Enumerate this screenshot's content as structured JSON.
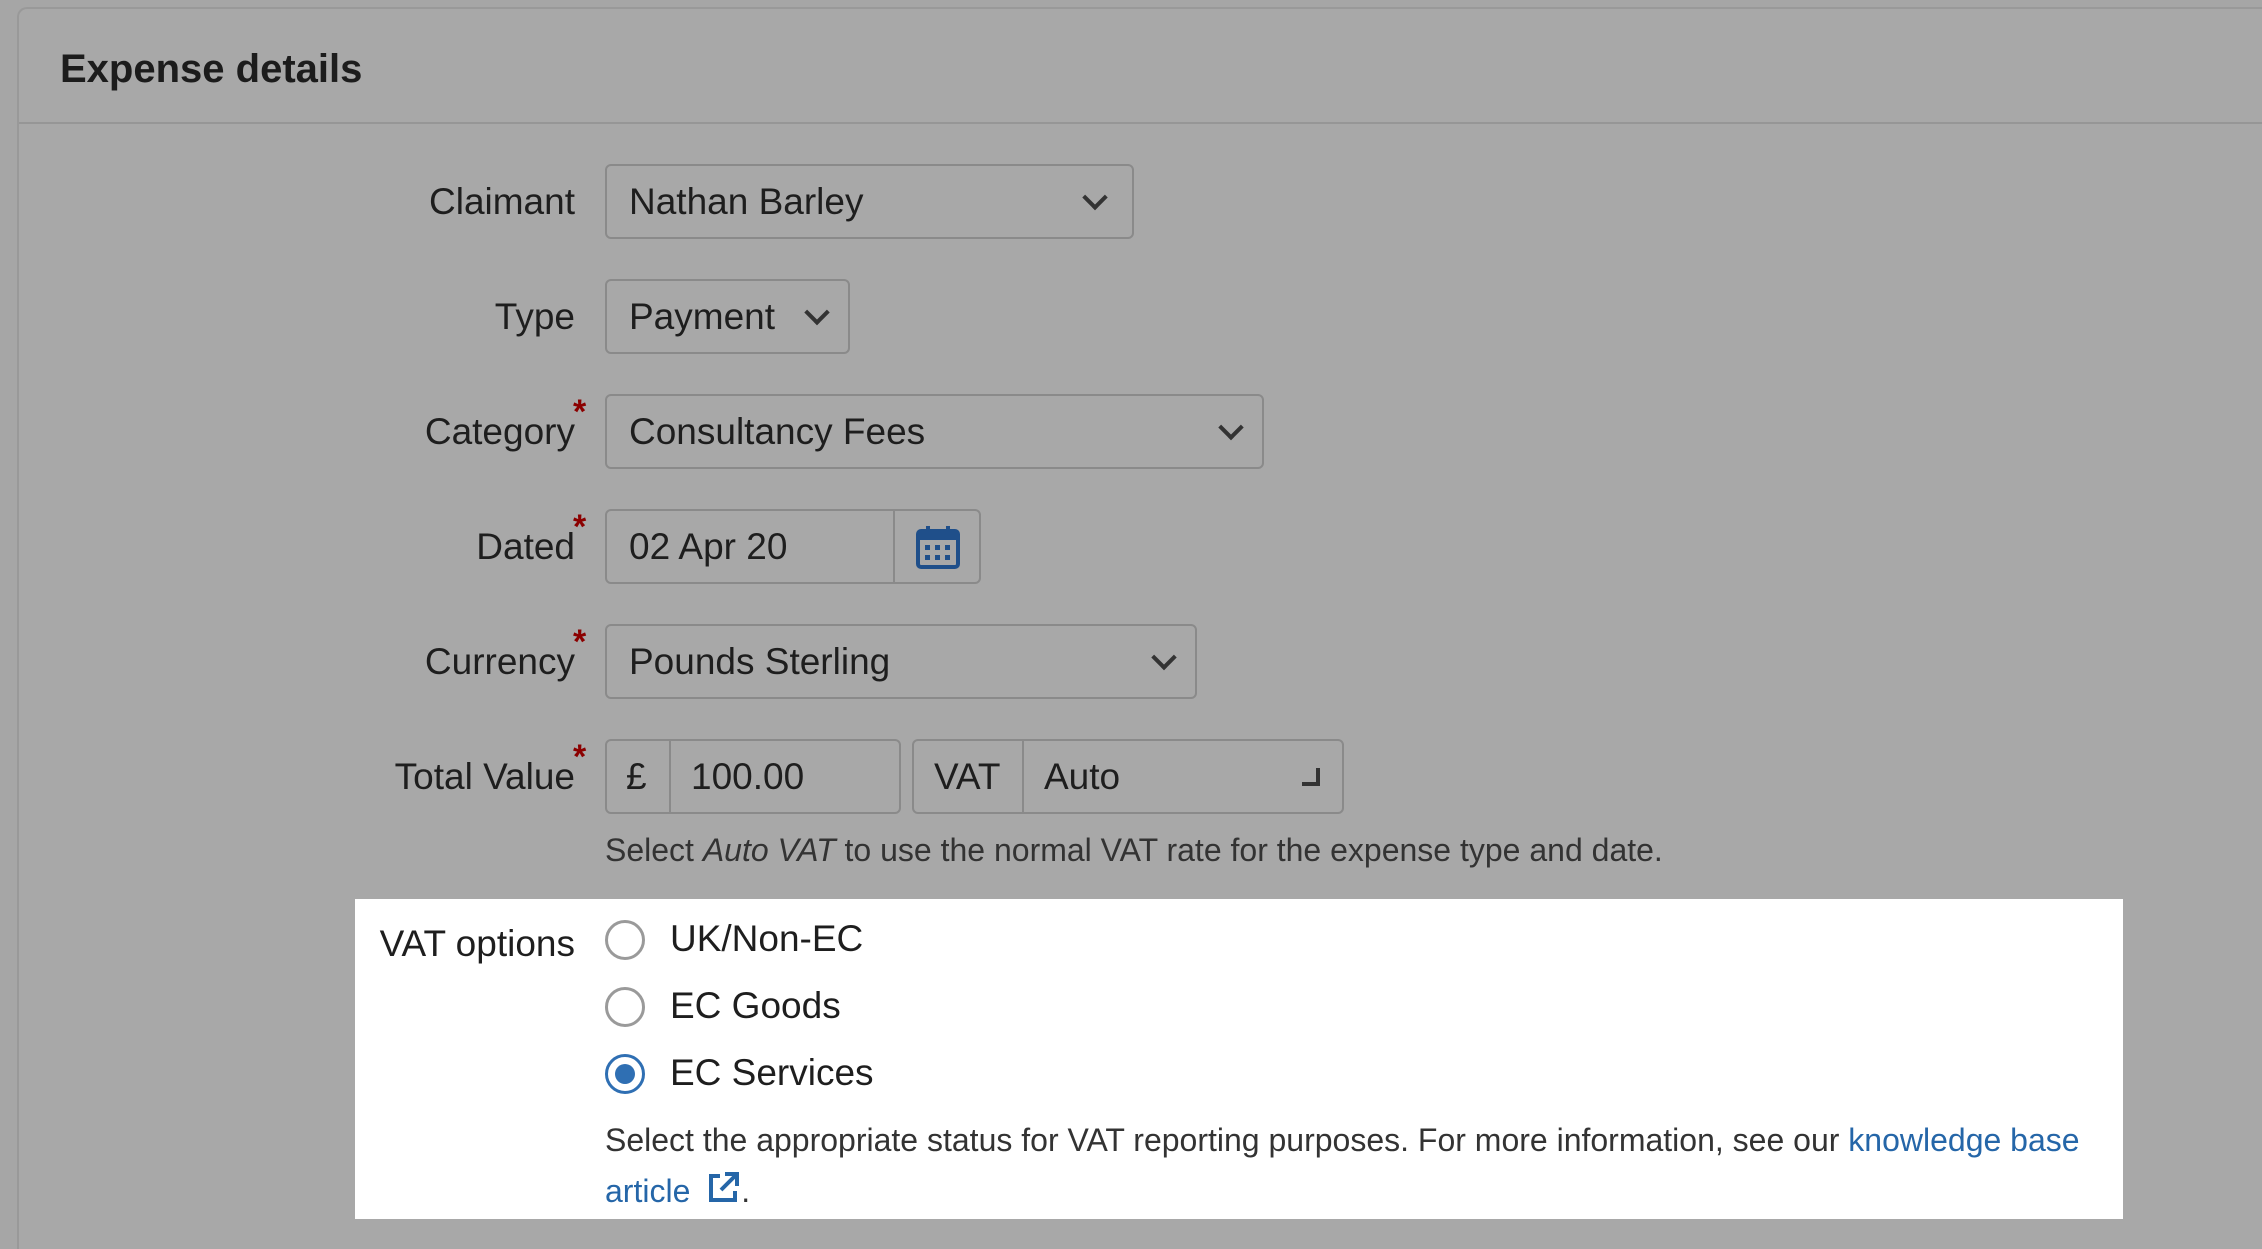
{
  "panel": {
    "title": "Expense details"
  },
  "fields": {
    "claimant": {
      "label": "Claimant",
      "value": "Nathan Barley"
    },
    "type": {
      "label": "Type",
      "value": "Payment"
    },
    "category": {
      "label": "Category",
      "value": "Consultancy Fees",
      "required_mark": "*"
    },
    "dated": {
      "label": "Dated",
      "value": "02 Apr 20",
      "required_mark": "*"
    },
    "currency": {
      "label": "Currency",
      "value": "Pounds Sterling",
      "required_mark": "*"
    },
    "total_value": {
      "label": "Total Value",
      "required_mark": "*",
      "currency_symbol": "£",
      "amount": "100.00",
      "vat_label": "VAT",
      "vat_value": "Auto",
      "help_pre": "Select ",
      "help_em": "Auto VAT",
      "help_post": " to use the normal VAT rate for the expense type and date."
    }
  },
  "vat_options": {
    "label": "VAT options",
    "options": [
      {
        "label": "UK/Non-EC",
        "checked": false
      },
      {
        "label": "EC Goods",
        "checked": false
      },
      {
        "label": "EC Services",
        "checked": true
      }
    ],
    "help_text": "Select the appropriate status for VAT reporting purposes. For more information, see our ",
    "link_text_1": "knowledge base",
    "link_text_2": "article",
    "help_end": "."
  },
  "colors": {
    "accent": "#2f6fb3",
    "required": "#8b0000",
    "link": "#2566a8"
  }
}
